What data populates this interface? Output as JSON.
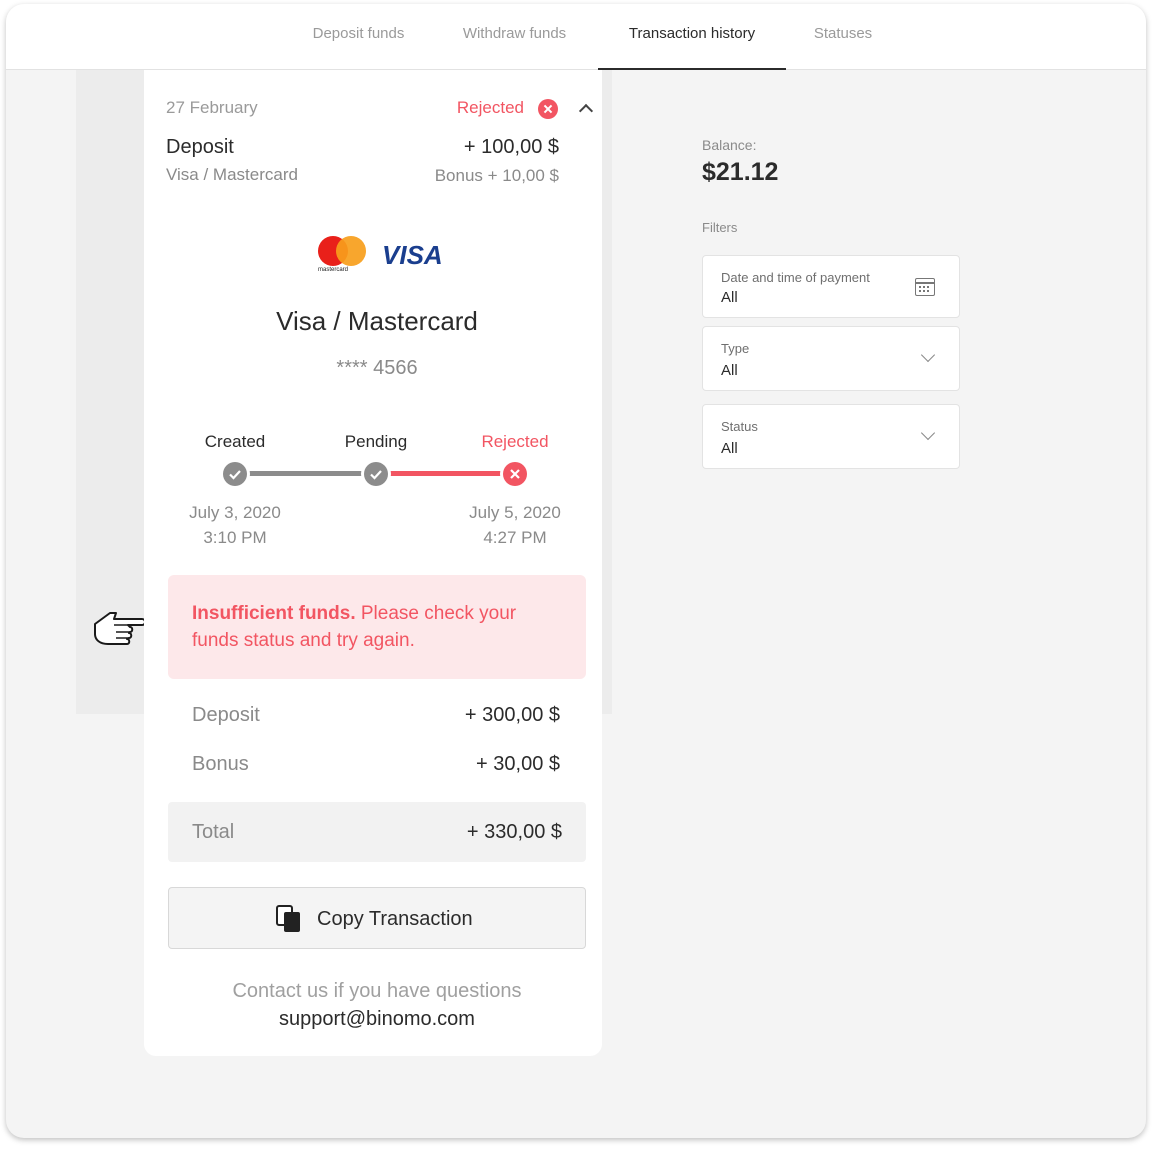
{
  "tabs": [
    {
      "label": "Deposit funds",
      "active": false
    },
    {
      "label": "Withdraw funds",
      "active": false
    },
    {
      "label": "Transaction history",
      "active": true
    },
    {
      "label": "Statuses",
      "active": false
    }
  ],
  "transaction": {
    "date": "27 February",
    "status": "Rejected",
    "type": "Deposit",
    "method": "Visa / Mastercard",
    "amount": "+ 100,00 $",
    "bonus": "Bonus + 10,00 $",
    "card_logos": {
      "mastercard_text": "mastercard",
      "visa_text": "VISA"
    },
    "card_title": "Visa / Mastercard",
    "card_number": "**** 4566",
    "timeline": {
      "steps": [
        {
          "label": "Created",
          "state": "done"
        },
        {
          "label": "Pending",
          "state": "done"
        },
        {
          "label": "Rejected",
          "state": "rejected"
        }
      ],
      "start": {
        "date": "July 3, 2020",
        "time": "3:10 PM"
      },
      "end": {
        "date": "July 5, 2020",
        "time": "4:27 PM"
      }
    },
    "alert": {
      "strong": "Insufficient funds.",
      "line1_rest": " Please check your",
      "line2": "funds status and try again."
    },
    "summary": {
      "deposit_label": "Deposit",
      "deposit_value": "+ 300,00 $",
      "bonus_label": "Bonus",
      "bonus_value": "+ 30,00 $",
      "total_label": "Total",
      "total_value": "+ 330,00 $"
    },
    "copy_button": "Copy Transaction",
    "contact_text": "Contact us if you have questions",
    "contact_email": "support@binomo.com"
  },
  "sidebar": {
    "balance_label": "Balance:",
    "balance_value": "$21.12",
    "filters_label": "Filters",
    "filters": [
      {
        "label": "Date and time of payment",
        "value": "All",
        "icon": "calendar-icon"
      },
      {
        "label": "Type",
        "value": "All",
        "icon": "chevron-down-icon"
      },
      {
        "label": "Status",
        "value": "All",
        "icon": "chevron-down-icon"
      }
    ]
  },
  "colors": {
    "rejected": "#f25562",
    "alert_bg": "#fde8ea",
    "done": "#8c8c8c",
    "text": "#2b2b2b",
    "muted": "#9a9a9a"
  },
  "icons": [
    "pointing-hand-icon",
    "rejected-x-icon",
    "chevron-up-icon",
    "copy-icon",
    "calendar-icon",
    "chevron-down-icon",
    "check-icon"
  ]
}
